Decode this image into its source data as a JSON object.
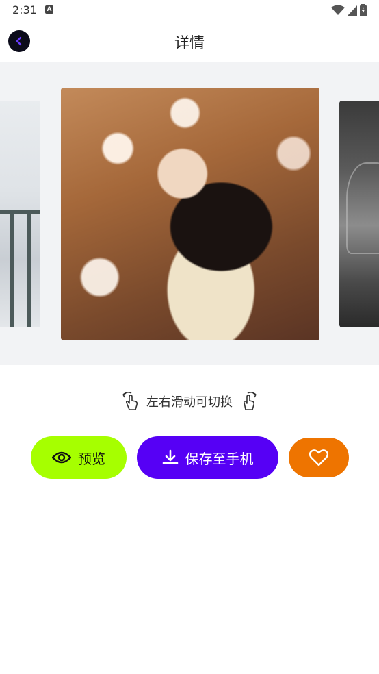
{
  "status_bar": {
    "time": "2:31",
    "notification_icon_letter": "A"
  },
  "header": {
    "title": "详情",
    "back_icon": "chevron-left-icon",
    "back_icon_color": "#6a3cff"
  },
  "gallery": {
    "hint": "左右滑动可切换"
  },
  "actions": {
    "preview_label": "预览",
    "save_label": "保存至手机",
    "favorite_icon": "heart-icon"
  },
  "colors": {
    "preview_bg": "#a6ff00",
    "save_bg": "#5600f5",
    "favorite_bg": "#ee7400"
  }
}
